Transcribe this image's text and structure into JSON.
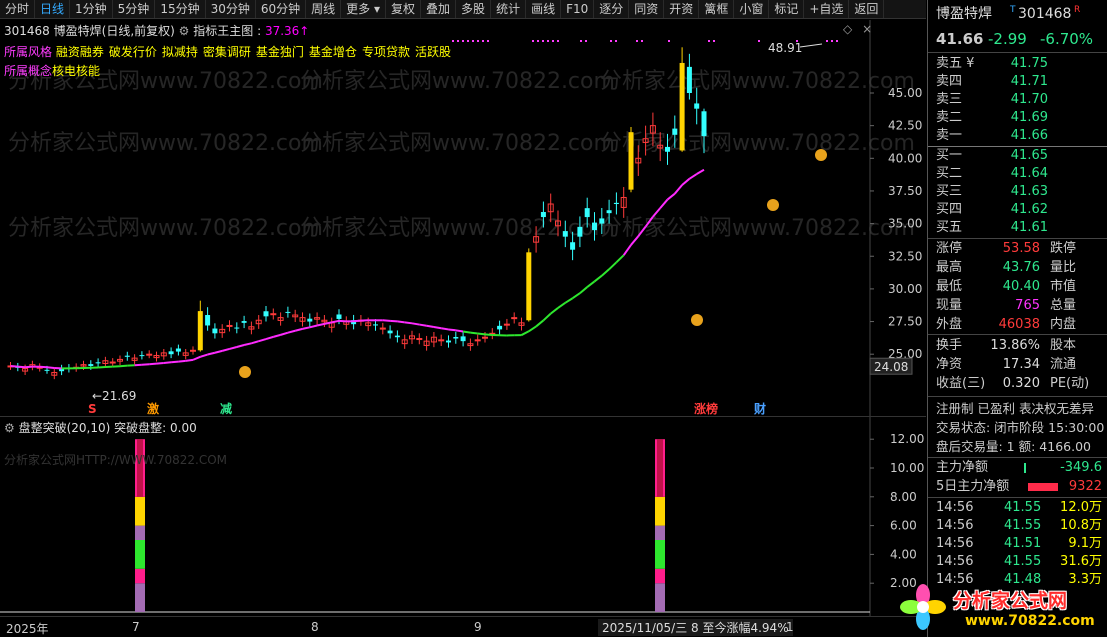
{
  "toolbar": {
    "items": [
      "分时",
      "日线",
      "1分钟",
      "5分钟",
      "15分钟",
      "30分钟",
      "60分钟",
      "周线",
      "更多 ▾",
      "复权",
      "叠加",
      "多股",
      "统计",
      "画线",
      "F10",
      "逐分",
      "同资",
      "开资",
      "篱框",
      "小窗",
      "标记",
      "+自选",
      "返回"
    ],
    "active_index": 1
  },
  "main": {
    "code": "301468",
    "name": "博盈特焊",
    "mode": "(日线,前复权)",
    "indicator_label": "指标王主图 :",
    "indicator_value": "37.36↑",
    "row2_prefix": "所属风格",
    "row2_tags": [
      "融资融券",
      "破发行价",
      "拟减持",
      "密集调研",
      "基金独门",
      "基金增仓",
      "专项贷款",
      "活跃股"
    ],
    "row3_prefix": "所属概念",
    "row3_tag": "核电核能",
    "high_label": "48.91",
    "low_label": "21.69",
    "last_price_tag": "24.08",
    "price_axis": [
      "45.00",
      "42.50",
      "40.00",
      "37.50",
      "35.00",
      "32.50",
      "30.00",
      "27.50",
      "25.00"
    ],
    "signals": [
      {
        "text": "S",
        "color": "#ff3b3b"
      },
      {
        "text": "激",
        "color": "#ff9a00"
      },
      {
        "text": "减",
        "color": "#2ee88e"
      },
      {
        "text": "涨榜",
        "color": "#ff3b3b"
      },
      {
        "text": "财",
        "color": "#4aa0ff"
      }
    ]
  },
  "sub": {
    "title": "盘整突破(20,10)",
    "line_label": "突破盘整:",
    "line_value": "0.00",
    "axis": [
      "12.00",
      "10.00",
      "8.00",
      "6.00",
      "4.00",
      "2.00"
    ]
  },
  "date_axis": {
    "labels": [
      "2025年",
      "7",
      "8",
      "9",
      "1"
    ],
    "status": "2025/11/05/三  8  至今涨幅4.94%"
  },
  "watermark": "分析家公式网www.70822.com",
  "watermark2": "分析家公式网HTTP://WWW.70822.COM",
  "quote": {
    "name": "博盈特焊",
    "code": "301468",
    "flag_t": "T",
    "flag_r": "R",
    "price": "41.66",
    "change": "-2.99",
    "pct": "-6.70%",
    "asks": [
      {
        "label": "卖五 ¥",
        "price": "41.75"
      },
      {
        "label": "卖四",
        "price": "41.71"
      },
      {
        "label": "卖三",
        "price": "41.70"
      },
      {
        "label": "卖二",
        "price": "41.69"
      },
      {
        "label": "卖一",
        "price": "41.66"
      }
    ],
    "bids": [
      {
        "label": "买一",
        "price": "41.65"
      },
      {
        "label": "买二",
        "price": "41.64"
      },
      {
        "label": "买三",
        "price": "41.63"
      },
      {
        "label": "买四",
        "price": "41.62"
      },
      {
        "label": "买五",
        "price": "41.61"
      }
    ],
    "stats": [
      {
        "l1": "涨停",
        "v1": "53.58",
        "c1": "up",
        "l2": "跌停"
      },
      {
        "l1": "最高",
        "v1": "43.76",
        "c1": "dn",
        "l2": "量比"
      },
      {
        "l1": "最低",
        "v1": "40.40",
        "c1": "dn",
        "l2": "市值"
      },
      {
        "l1": "现量",
        "v1": "765",
        "c1": "mg",
        "l2": "总量"
      },
      {
        "l1": "外盘",
        "v1": "46038",
        "c1": "up",
        "l2": "内盘"
      }
    ],
    "stats2": [
      {
        "l1": "换手",
        "v1": "13.86%",
        "l2": "股本"
      },
      {
        "l1": "净资",
        "v1": "17.34",
        "l2": "流通"
      },
      {
        "l1": "收益(三)",
        "v1": "0.320",
        "l2": "PE(动)"
      }
    ],
    "reg_line": "注册制 已盈利 表决权无差异",
    "trade_status": "交易状态: 闭市阶段 15:30:00",
    "after_hours": "盘后交易量: 1  额: 4166.00",
    "net_label": "主力净额",
    "net_value": "-349.6",
    "net5_label": "5日主力净额",
    "net5_value": "9322",
    "ticks": [
      {
        "t": "14:56",
        "p": "41.55",
        "v": "12.0万"
      },
      {
        "t": "14:56",
        "p": "41.55",
        "v": "10.8万"
      },
      {
        "t": "14:56",
        "p": "41.51",
        "v": "9.1万"
      },
      {
        "t": "14:56",
        "p": "41.55",
        "v": "31.6万"
      },
      {
        "t": "14:56",
        "p": "41.48",
        "v": "3.3万"
      }
    ]
  },
  "logo_text": "分析家公式网",
  "logo_url": "www.70822.com"
}
